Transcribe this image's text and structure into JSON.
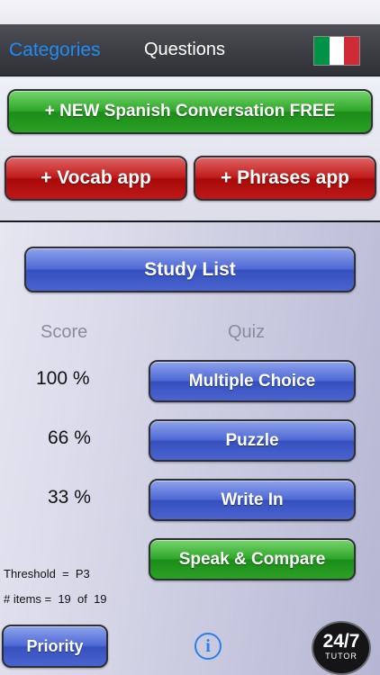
{
  "nav": {
    "back_label": "Categories",
    "title": "Questions",
    "flag_colors": [
      "#009246",
      "#ffffff",
      "#ce2b37"
    ]
  },
  "promos": {
    "new_app_label": "+ NEW  Spanish Conversation  FREE",
    "vocab_label": "+ Vocab app",
    "phrases_label": "+ Phrases app"
  },
  "study_list_label": "Study List",
  "headers": {
    "score": "Score",
    "quiz": "Quiz"
  },
  "scores": [
    "100 %",
    "66 %",
    "33 %"
  ],
  "quiz_buttons": {
    "multiple_choice": "Multiple Choice",
    "puzzle": "Puzzle",
    "write_in": "Write In",
    "speak_compare": "Speak & Compare"
  },
  "threshold_text": "Threshold  =  P3",
  "items_text": "# items =  19  of  19",
  "priority_label": "Priority",
  "info_icon": "info-icon",
  "tutor_badge": {
    "big": "24/7",
    "small": "TUTOR"
  },
  "colors": {
    "accent_blue": "#1f8cf5",
    "green": "#2fa72a",
    "red": "#c01b1b",
    "blue_button": "#4f69d5"
  }
}
